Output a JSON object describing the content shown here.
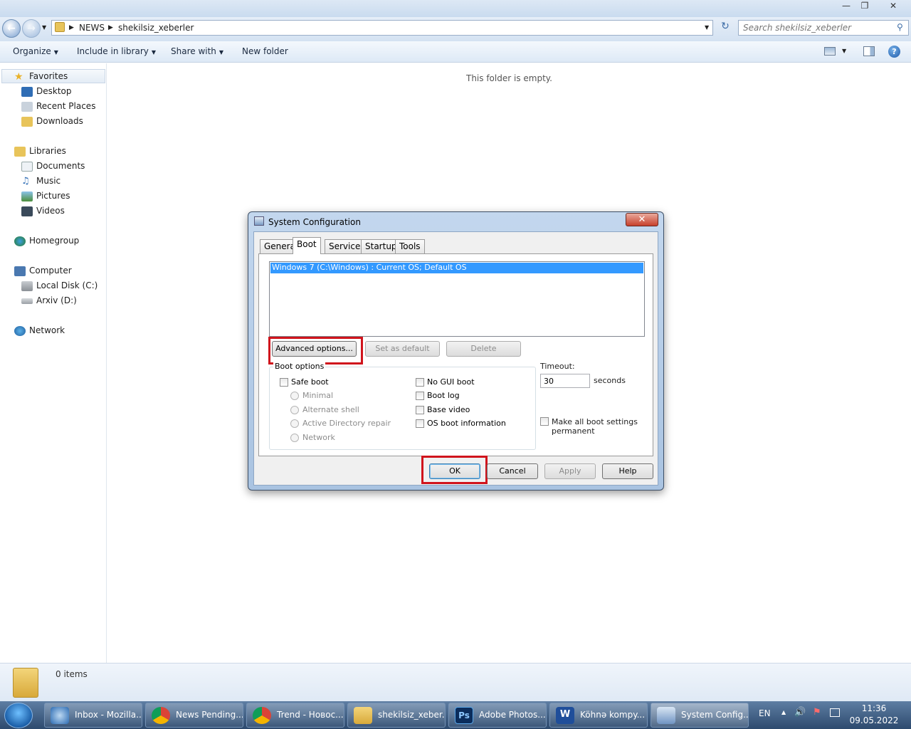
{
  "explorer": {
    "breadcrumb": [
      "NEWS",
      "shekilsiz_xeberler"
    ],
    "search_placeholder": "Search shekilsiz_xeberler",
    "commands": {
      "organize": "Organize",
      "include_in_library": "Include in library",
      "share_with": "Share with",
      "new_folder": "New folder"
    },
    "nav": {
      "favorites": "Favorites",
      "desktop": "Desktop",
      "recent_places": "Recent Places",
      "downloads": "Downloads",
      "libraries": "Libraries",
      "documents": "Documents",
      "music": "Music",
      "pictures": "Pictures",
      "videos": "Videos",
      "homegroup": "Homegroup",
      "computer": "Computer",
      "local_disk": "Local Disk (C:)",
      "arxiv": "Arxiv (D:)",
      "network": "Network"
    },
    "empty_message": "This folder is empty.",
    "item_count": "0 items"
  },
  "dialog": {
    "title": "System Configuration",
    "tabs": {
      "general": "General",
      "boot": "Boot",
      "services": "Services",
      "startup": "Startup",
      "tools": "Tools"
    },
    "os_entry": "Windows 7 (C:\\Windows) : Current OS; Default OS",
    "buttons": {
      "advanced": "Advanced options...",
      "set_default": "Set as default",
      "delete": "Delete",
      "ok": "OK",
      "cancel": "Cancel",
      "apply": "Apply",
      "help": "Help"
    },
    "boot_options_label": "Boot options",
    "safe_boot": "Safe boot",
    "minimal": "Minimal",
    "alternate_shell": "Alternate shell",
    "active_directory_repair": "Active Directory repair",
    "network": "Network",
    "no_gui_boot": "No GUI boot",
    "boot_log": "Boot log",
    "base_video": "Base video",
    "os_boot_info": "OS boot information",
    "timeout_label": "Timeout:",
    "timeout_value": "30",
    "seconds_label": "seconds",
    "make_permanent_line1": "Make all boot settings",
    "make_permanent_line2": "permanent"
  },
  "taskbar": {
    "items": [
      "Inbox - Mozilla...",
      "News Pending...",
      "Trend - Новос...",
      "shekilsiz_xeber...",
      "Adobe Photos...",
      "Köhnə kompy...",
      "System Config..."
    ],
    "language": "EN",
    "time": "11:36",
    "date": "09.05.2022"
  },
  "colors": {
    "highlight": "#3399ff",
    "annotation_red": "#d0141c"
  }
}
